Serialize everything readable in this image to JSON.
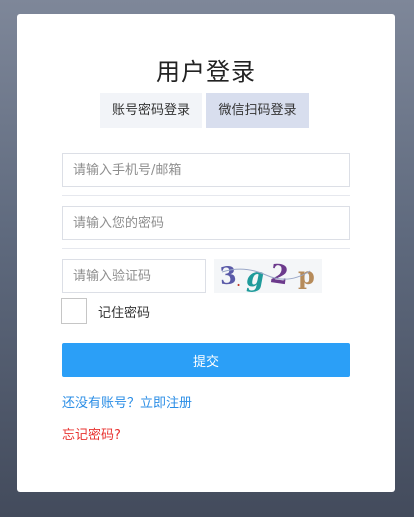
{
  "page": {
    "title": "用户登录"
  },
  "tabs": [
    {
      "label": "账号密码登录",
      "active": true
    },
    {
      "label": "微信扫码登录",
      "active": false
    }
  ],
  "form": {
    "phone_placeholder": "请输入手机号/邮箱",
    "phone_value": "",
    "password_placeholder": "请输入您的密码",
    "password_value": "",
    "code_placeholder": "请输入验证码",
    "code_value": "",
    "captcha_text": "3.g2p",
    "remember_label": "记住密码",
    "remember_checked": false,
    "submit_label": "提交"
  },
  "links": {
    "register": "还没有账号？立即注册",
    "forgot": "忘记密码?"
  },
  "colors": {
    "accent": "#2b9ff7",
    "link": "#2b8ee6",
    "forgot": "#e8322f",
    "active_tab_bg": "#f2f4f8",
    "inactive_tab_bg": "#d8deee"
  }
}
